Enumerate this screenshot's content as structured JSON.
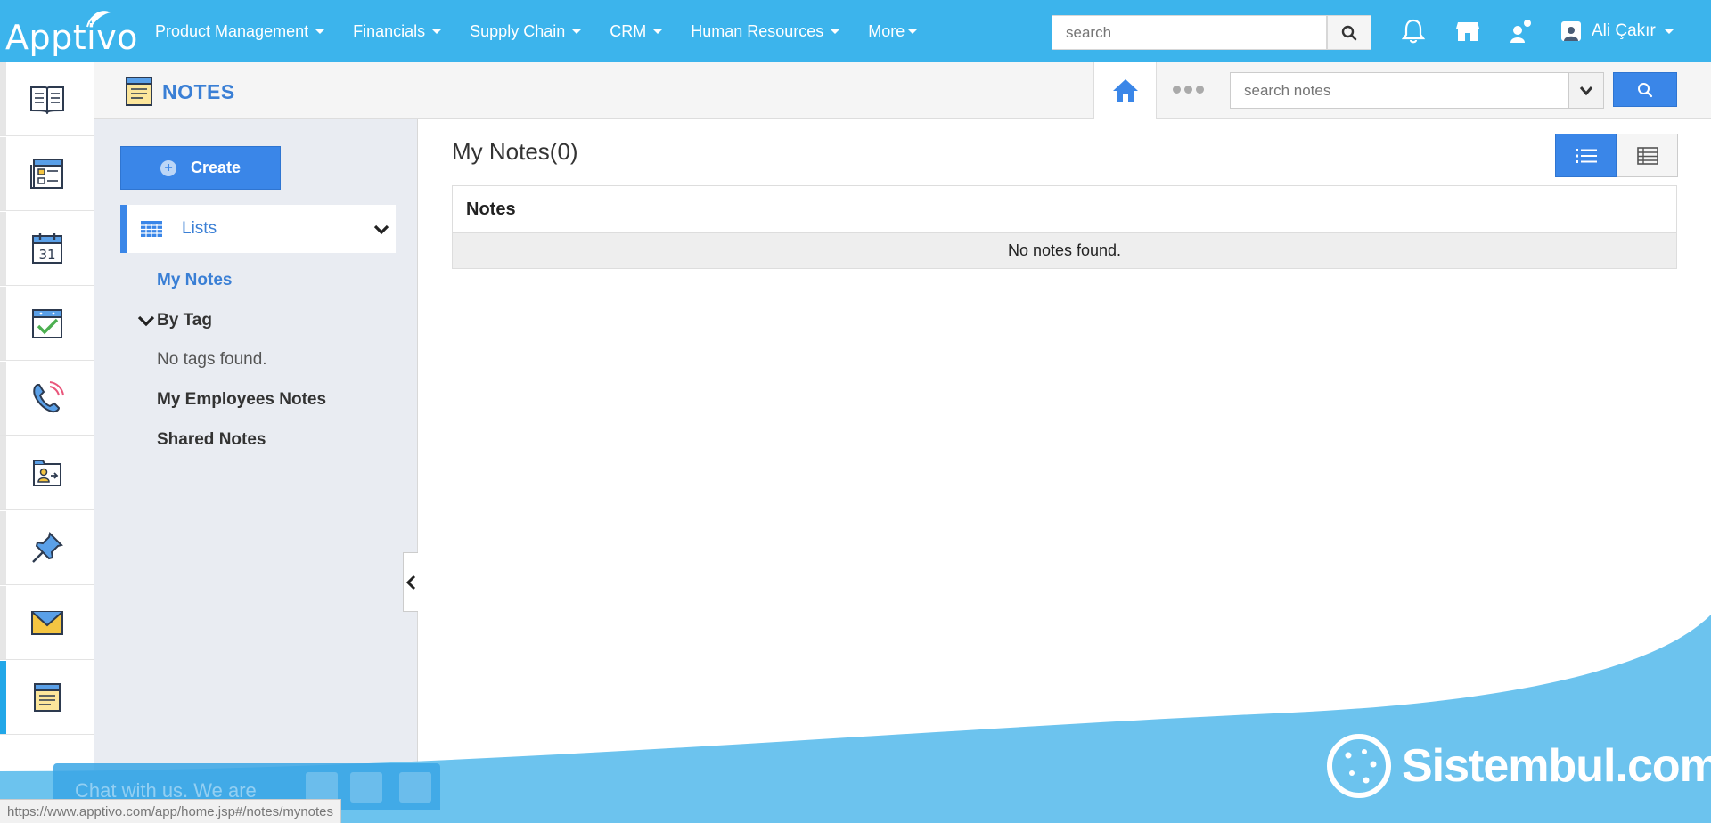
{
  "brand": {
    "logo_text": "Apptivo",
    "accent": "#3cb4ec",
    "primary_button": "#3a86e8"
  },
  "nav": {
    "items": [
      {
        "label": "Product Management"
      },
      {
        "label": "Financials"
      },
      {
        "label": "Supply Chain"
      },
      {
        "label": "CRM"
      },
      {
        "label": "Human Resources"
      },
      {
        "label": "More"
      }
    ]
  },
  "global_search": {
    "placeholder": "search"
  },
  "user": {
    "name": "Ali Çakır"
  },
  "rail": {
    "items": [
      {
        "icon": "book-icon"
      },
      {
        "icon": "form-icon"
      },
      {
        "icon": "calendar-icon",
        "text": "31"
      },
      {
        "icon": "task-check-icon"
      },
      {
        "icon": "phone-call-icon"
      },
      {
        "icon": "contact-card-icon"
      },
      {
        "icon": "pin-icon"
      },
      {
        "icon": "email-icon"
      },
      {
        "icon": "notes-icon"
      }
    ]
  },
  "app": {
    "title": "NOTES",
    "search_placeholder": "search notes"
  },
  "sidebar": {
    "create_label": "Create",
    "lists_label": "Lists",
    "my_notes": "My Notes",
    "by_tag": "By Tag",
    "no_tags": "No tags found.",
    "employees_notes": "My Employees Notes",
    "shared_notes": "Shared Notes"
  },
  "main": {
    "title": "My Notes(0)",
    "table": {
      "column_header": "Notes",
      "empty_message": "No notes found."
    }
  },
  "watermark": {
    "text": "Sistembul.com"
  },
  "chat": {
    "text": "Chat with us. We are"
  },
  "status_bar": {
    "url": "https://www.apptivo.com/app/home.jsp#/notes/mynotes"
  }
}
